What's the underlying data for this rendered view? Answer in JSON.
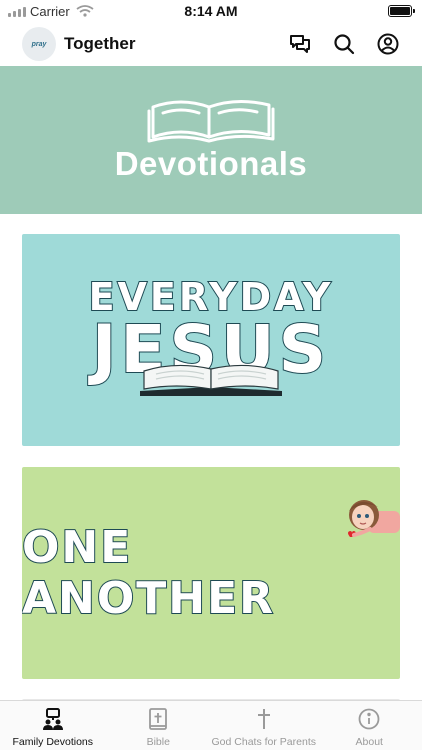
{
  "status_bar": {
    "carrier": "Carrier",
    "time": "8:14 AM"
  },
  "header": {
    "logo_text": "pray",
    "title": "Together",
    "actions": [
      "chat-icon",
      "search-icon",
      "account-icon"
    ]
  },
  "hero": {
    "title": "Devotionals"
  },
  "cards": [
    {
      "line1": "EVERYDAY",
      "line2": "JESUS",
      "color": "#9fdad8"
    },
    {
      "title": "ONE ANOTHER",
      "color": "#c2e19a"
    }
  ],
  "tabs": [
    {
      "label": "Family Devotions",
      "icon": "family-icon",
      "active": true
    },
    {
      "label": "Bible",
      "icon": "bible-icon",
      "active": false
    },
    {
      "label": "God Chats for Parents",
      "icon": "cross-icon",
      "active": false
    },
    {
      "label": "About",
      "icon": "info-icon",
      "active": false
    }
  ],
  "colors": {
    "hero": "#9ecbb8",
    "tab_active": "#111111",
    "tab_inactive": "#9a9a9a"
  }
}
